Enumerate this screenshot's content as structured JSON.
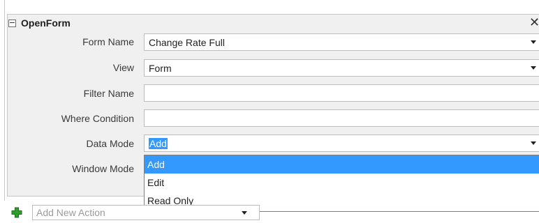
{
  "action": {
    "title": "OpenForm",
    "collapse_glyph": "−",
    "close_glyph": "✕"
  },
  "arguments": {
    "form_name": {
      "label": "Form Name",
      "value": "Change Rate Full"
    },
    "view": {
      "label": "View",
      "value": "Form"
    },
    "filter_name": {
      "label": "Filter Name",
      "value": ""
    },
    "where_condition": {
      "label": "Where Condition",
      "value": ""
    },
    "data_mode": {
      "label": "Data Mode",
      "value": "Add"
    },
    "window_mode": {
      "label": "Window Mode",
      "value": ""
    }
  },
  "data_mode_dropdown": {
    "options": [
      "Add",
      "Edit",
      "Read Only"
    ],
    "highlighted": "Add"
  },
  "add_new_action": {
    "placeholder": "Add New Action"
  },
  "colors": {
    "selection": "#3399ff",
    "plus_icon": "#2e9e2e",
    "panel_background": "#f0f0f0"
  },
  "icons": {
    "collapse": "minus-box-icon",
    "close": "close-icon",
    "dropdown": "chevron-down-icon",
    "add": "green-plus-icon"
  }
}
